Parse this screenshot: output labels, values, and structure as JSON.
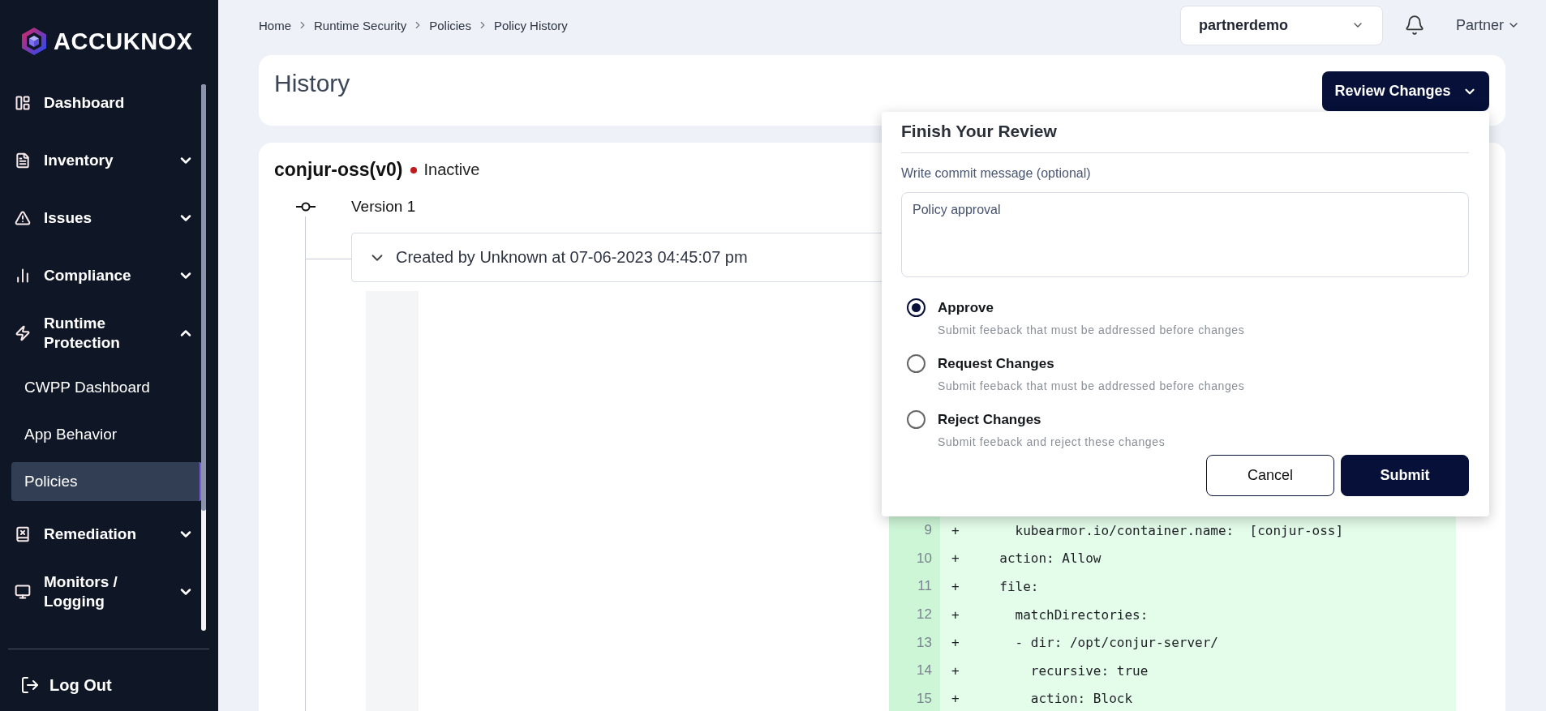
{
  "sidebar": {
    "logo": "ACCUKNOX",
    "items": [
      {
        "kind": "link",
        "label": "Dashboard"
      },
      {
        "kind": "group",
        "label": "Inventory",
        "expanded": false
      },
      {
        "kind": "group",
        "label": "Issues",
        "expanded": false
      },
      {
        "kind": "group",
        "label": "Compliance",
        "expanded": false
      },
      {
        "kind": "group",
        "label": "Runtime Protection",
        "expanded": true,
        "children": [
          {
            "label": "CWPP Dashboard",
            "selected": false
          },
          {
            "label": "App Behavior",
            "selected": false
          },
          {
            "label": "Policies",
            "selected": true
          }
        ]
      },
      {
        "kind": "group",
        "label": "Remediation",
        "expanded": false
      },
      {
        "kind": "group",
        "label": "Monitors / Logging",
        "expanded": false
      }
    ],
    "logout": "Log Out"
  },
  "breadcrumb": [
    "Home",
    "Runtime Security",
    "Policies",
    "Policy History"
  ],
  "workspace": {
    "value": "partnerdemo"
  },
  "user": "Partner",
  "page_title": "History",
  "review_button": "Review Changes",
  "policy": {
    "name": "conjur-oss(v0)",
    "status": "Inactive",
    "active": false,
    "version": "Version 1",
    "entry": {
      "title": "Created by Unknown at 07-06-2023 04:45:07 pm",
      "expanded": true
    },
    "diff_lines": [
      {
        "number": "9",
        "sign": "+",
        "text": "    kubearmor.io/container.name:  [conjur-oss]"
      },
      {
        "number": "10",
        "sign": "+",
        "text": "  action: Allow"
      },
      {
        "number": "11",
        "sign": "+",
        "text": "  file:"
      },
      {
        "number": "12",
        "sign": "+",
        "text": "    matchDirectories:"
      },
      {
        "number": "13",
        "sign": "+",
        "text": "    - dir: /opt/conjur-server/"
      },
      {
        "number": "14",
        "sign": "+",
        "text": "      recursive: true"
      },
      {
        "number": "15",
        "sign": "+",
        "text": "      action: Block"
      }
    ]
  },
  "review_panel": {
    "title": "Finish Your Review",
    "message_label": "Write commit message (optional)",
    "message": "Policy approval",
    "options": [
      {
        "label": "Approve",
        "description": "Submit feeback that must be addressed before changes",
        "selected": true
      },
      {
        "label": "Request Changes",
        "description": "Submit feeback that must be addressed before changes",
        "selected": false
      },
      {
        "label": "Reject Changes",
        "description": "Submit feeback and reject these changes",
        "selected": false
      }
    ],
    "buttons": [
      "Cancel",
      "Submit"
    ]
  }
}
